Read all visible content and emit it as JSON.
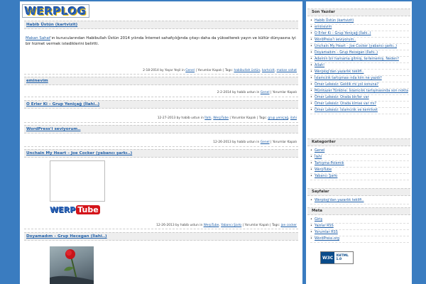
{
  "site": {
    "logo_text": "WERPLOG"
  },
  "posts": [
    {
      "title": "Habib Üstün (kartvizit)",
      "link_text": "Makan Sahat",
      "body": "'ın kurucularından Habibullah Üstün 2014 yılında İnternet sahafçılığında çıtayı daha da yükselterek yayın ve kültür dünyasına iyi bir hizmet vermek istediklerini belirtti.",
      "meta_prefix": "2-18-2014 by Yaşar Yeşil in",
      "category": "Genel",
      "comments": "Yorumlar Kapalı",
      "tags_label": "Tags:",
      "tags": [
        "habibullah üstün",
        "kartvizit",
        "makan sahat"
      ]
    },
    {
      "title": "eminevim",
      "meta_prefix": "2-2-2014 by habib ustun in",
      "category": "Genel",
      "comments": "Yorumlar Kapalı"
    },
    {
      "title": "O Erler Ki – Grup Yeniçağ (İlahi..)",
      "meta_prefix": "12-27-2013 by habib ustun in",
      "category": "İlahi",
      "category2": "WerpTube",
      "comments": "Yorumlar Kapalı",
      "tags_label": "Tags:",
      "tags": [
        "grup yeniçağ",
        "ilahi"
      ]
    },
    {
      "title": "WordPress'i seviyorum..",
      "meta_prefix": "12-26-2013 by habib ustun in",
      "category": "Genel",
      "comments": "Yorumlar Kapalı"
    },
    {
      "title": "Unchain My Heart – Joe Cocker (yabancı şarkı..)",
      "meta_prefix": "12-26-2013 by habib ustun in",
      "category": "WerpTube",
      "category2": "Yabancı Şarkı",
      "comments": "Yorumlar Kapalı",
      "tags_label": "Tags:",
      "tags": [
        "joe cocker"
      ]
    },
    {
      "title": "Doyamadım – Grup Hecegan (İlahi..)"
    }
  ],
  "werptube": {
    "a": "WERP",
    "b": "Tube"
  },
  "sidebar": {
    "recent_title": "Son Yazılar",
    "recent": [
      "Habib Üstün (kartvizit)",
      "eminevim",
      "O Erler Ki – Grup Yeniçağ (İlahi..)",
      "WordPress'i seviyorum..",
      "Unchain My Heart – Joe Cocker (yabancı şarkı..)",
      "Doyamadım – Grup Hecegan (İlahi..)",
      "Ademin bir hamama gitmiş, terlememiş. Neden?",
      "Allah!",
      "Werplog'dan yazarlık teklifi..",
      "İslamcılık tartışması nda kim ne yazdı?",
      "Ömer Lekesiz: Geldik mi yol sonuna?",
      "Mümtazer Türköne: İslamcılık tartışmasında son nokta",
      "Ömer Lekesiz: Orada bir/ler var",
      "Ömer Lekesiz: Orada kimse var mı?",
      "Ömer Lekesiz: İslamcılık ve kemlivet"
    ],
    "cat_title": "Kategoriler",
    "categories": [
      "Genel",
      "İlahi",
      "Tartışma-Polemik",
      "WerpTube",
      "Yabancı Şarkı"
    ],
    "pages_title": "Sayfalar",
    "pages": [
      "Werplog'dan yazarlık teklifi.."
    ],
    "meta_title": "Meta",
    "meta": [
      "Giriş",
      "Yazılar RSS",
      "Yorumlar RSS",
      "WordPress.org"
    ],
    "w3c_a": "W3C",
    "w3c_b1": "XHTML",
    "w3c_b2": "1.0"
  }
}
